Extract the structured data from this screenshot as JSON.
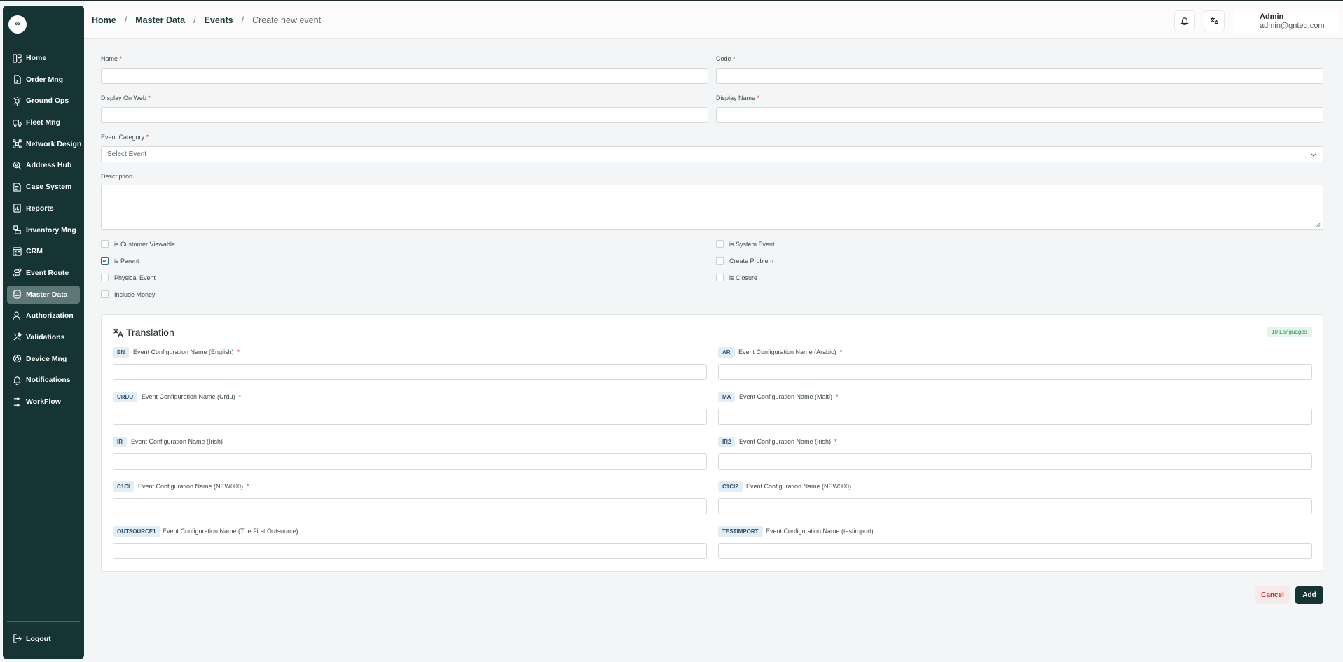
{
  "logo": "∞",
  "sidebar": {
    "items": [
      {
        "label": "Home",
        "icon": "home-icon"
      },
      {
        "label": "Order Mng",
        "icon": "order-icon"
      },
      {
        "label": "Ground Ops",
        "icon": "ground-ops-icon"
      },
      {
        "label": "Fleet Mng",
        "icon": "truck-icon"
      },
      {
        "label": "Network Design",
        "icon": "network-icon"
      },
      {
        "label": "Address Hub",
        "icon": "address-icon"
      },
      {
        "label": "Case System",
        "icon": "case-icon"
      },
      {
        "label": "Reports",
        "icon": "reports-icon"
      },
      {
        "label": "Inventory Mng",
        "icon": "inventory-icon"
      },
      {
        "label": "CRM",
        "icon": "crm-icon"
      },
      {
        "label": "Event Route",
        "icon": "route-icon"
      },
      {
        "label": "Master Data",
        "icon": "database-icon",
        "active": true
      },
      {
        "label": "Authorization",
        "icon": "user-icon"
      },
      {
        "label": "Validations",
        "icon": "tools-icon"
      },
      {
        "label": "Device Mng",
        "icon": "device-icon"
      },
      {
        "label": "Notifications",
        "icon": "bell-icon"
      },
      {
        "label": "WorkFlow",
        "icon": "workflow-icon"
      }
    ],
    "logout": "Logout"
  },
  "header": {
    "breadcrumb": [
      "Home",
      "Master Data",
      "Events"
    ],
    "current": "Create new event",
    "separator": "/",
    "user": {
      "name": "Admin",
      "email": "admin@gnteq.com"
    }
  },
  "form": {
    "name_label": "Name",
    "code_label": "Code",
    "display_on_web_label": "Display On Web",
    "display_name_label": "Display Name",
    "event_category_label": "Event Category",
    "event_category_placeholder": "Select Event",
    "description_label": "Description",
    "required_mark": "*",
    "checkboxes": {
      "is_customer_viewable": {
        "label": "is Customer Viewable",
        "checked": false
      },
      "is_parent": {
        "label": "is Parent",
        "checked": true
      },
      "physical_event": {
        "label": "Physical Event",
        "checked": false
      },
      "include_money": {
        "label": "Include Money",
        "checked": false
      },
      "is_system_event": {
        "label": "is System Event",
        "checked": false
      },
      "create_problem": {
        "label": "Create Problem",
        "checked": false
      },
      "is_closure": {
        "label": "is Closure",
        "checked": false
      }
    }
  },
  "translation": {
    "title": "Translation",
    "badge": "10 Languages",
    "fields": [
      {
        "code": "EN",
        "label": "Event Configuration Name (English)",
        "required": true
      },
      {
        "code": "AR",
        "label": "Event Configuration Name (Arabic)",
        "required": true
      },
      {
        "code": "URDU",
        "label": "Event Configuration Name (Urdu)",
        "required": true
      },
      {
        "code": "MA",
        "label": "Event Configuration Name (Malti)",
        "required": true
      },
      {
        "code": "IR",
        "label": "Event Configuration Name (Irish)",
        "required": false
      },
      {
        "code": "IR2",
        "label": "Event Configuration Name (Irish)",
        "required": true
      },
      {
        "code": "C1CI",
        "label": "Event Configuration Name (NEW000)",
        "required": true
      },
      {
        "code": "C1CI2",
        "label": "Event Configuration Name (NEW000)",
        "required": false
      },
      {
        "code": "OUTSOURCE1",
        "label": "Event Configuration Name (The First Outsource)",
        "required": false
      },
      {
        "code": "TESTIMPORT",
        "label": "Event Configuration Name (testimport)",
        "required": false
      }
    ]
  },
  "actions": {
    "cancel": "Cancel",
    "add": "Add"
  }
}
